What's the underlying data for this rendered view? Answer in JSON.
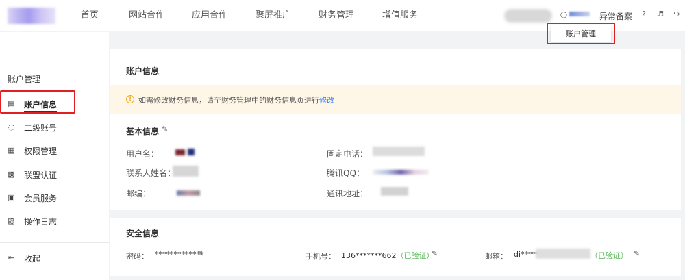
{
  "header": {
    "nav": [
      "首页",
      "网站合作",
      "应用合作",
      "聚屏推广",
      "财务管理",
      "增值服务"
    ],
    "anomaly_label": "异常备案",
    "dropdown_label": "账户管理"
  },
  "sidebar": {
    "section_title": "账户管理",
    "items": [
      {
        "label": "账户信息",
        "icon": "profile-icon",
        "active": true
      },
      {
        "label": "二级账号",
        "icon": "sub-account-icon",
        "active": false
      },
      {
        "label": "权限管理",
        "icon": "permission-icon",
        "active": false
      },
      {
        "label": "联盟认证",
        "icon": "certification-icon",
        "active": false
      },
      {
        "label": "会员服务",
        "icon": "member-icon",
        "active": false
      },
      {
        "label": "操作日志",
        "icon": "log-icon",
        "active": false
      }
    ],
    "collapse_label": "收起"
  },
  "account": {
    "title": "账户信息",
    "notice_text": "如需修改财务信息，请至财务管理中的财务信息页进行",
    "notice_link": "修改",
    "basic_title": "基本信息",
    "fields_left": [
      "用户名：",
      "联系人姓名：",
      "邮编："
    ],
    "fields_right": [
      "固定电话：",
      "腾讯QQ：",
      "通讯地址："
    ]
  },
  "security": {
    "title": "安全信息",
    "password_label": "密码：",
    "password_value": "*************",
    "phone_label": "手机号：",
    "phone_value": "136*******662",
    "phone_status": "（已验证）",
    "email_label": "邮箱：",
    "email_value": "di*****",
    "email_status": "（已验证）"
  },
  "colors": {
    "highlight": "#e02020",
    "link": "#3d7ee6",
    "verified": "#5cb85c",
    "notice_bg": "#fef6e7"
  }
}
